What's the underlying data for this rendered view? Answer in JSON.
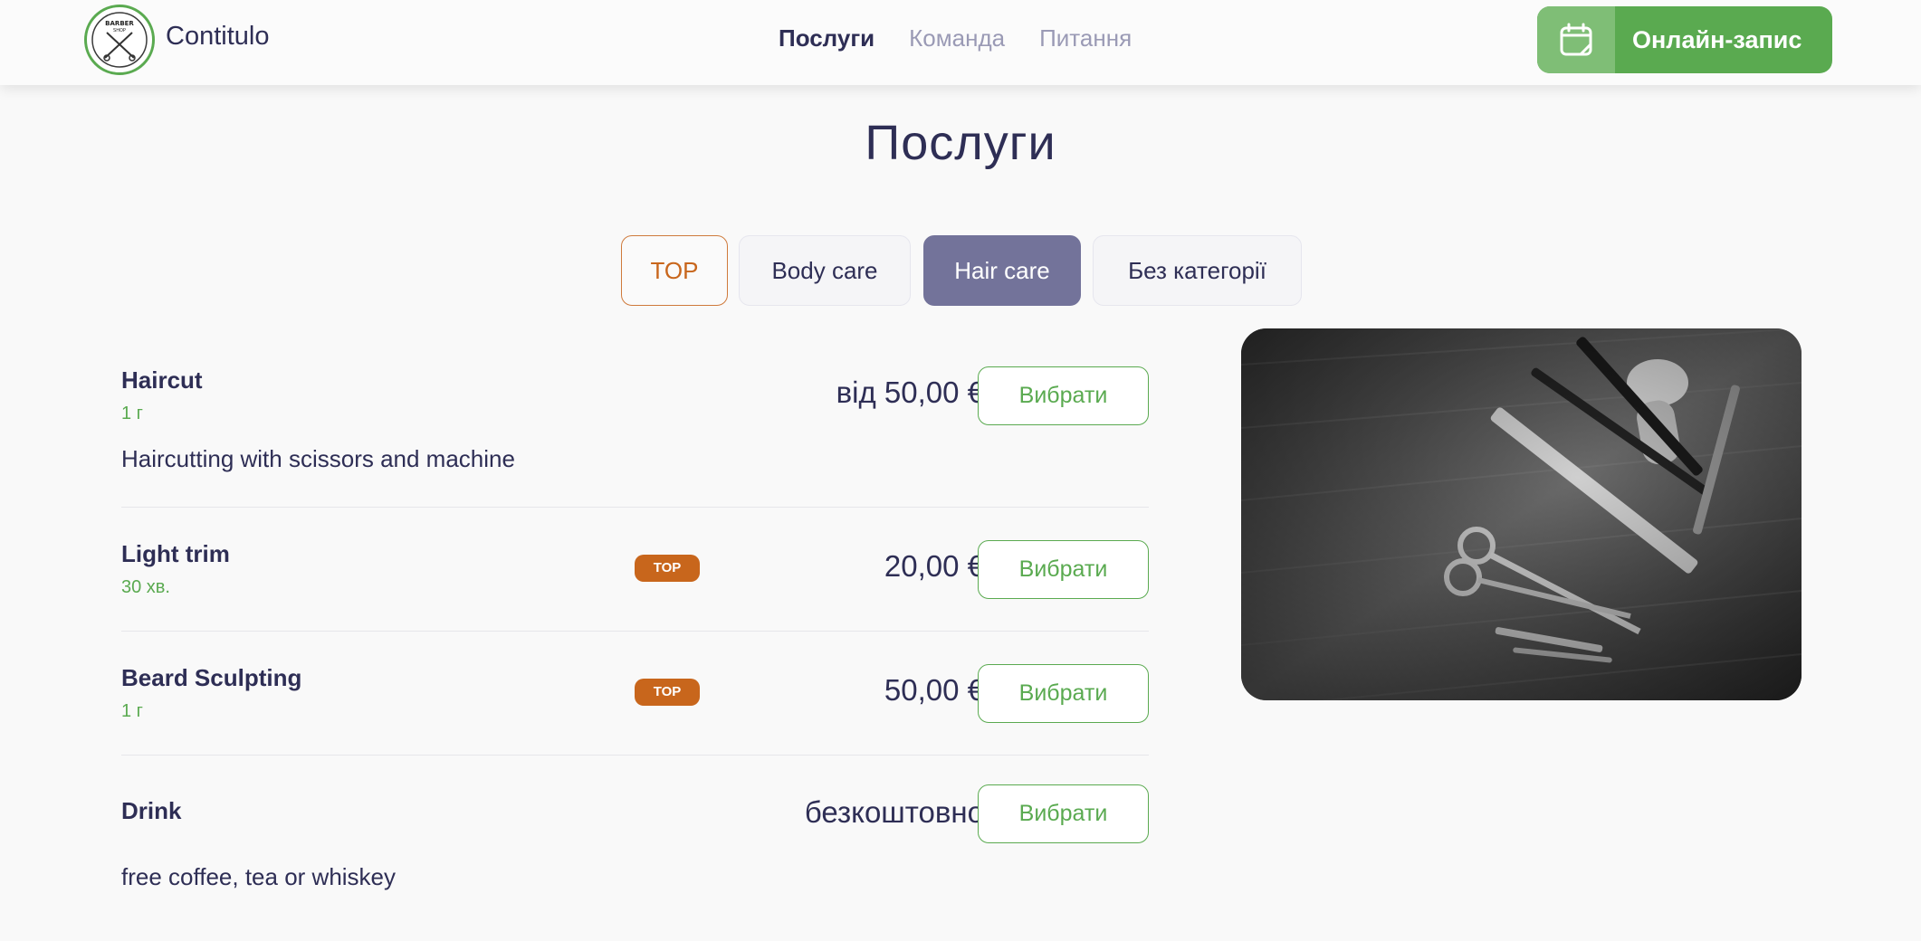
{
  "header": {
    "brand": "Contitulo",
    "logo_text": "BARBER SHOP",
    "nav": [
      {
        "label": "Послуги",
        "active": true
      },
      {
        "label": "Команда",
        "active": false
      },
      {
        "label": "Питання",
        "active": false
      }
    ],
    "cta": {
      "label": "Онлайн-запис",
      "icon": "calendar-icon"
    }
  },
  "page_title": "Послуги",
  "tabs": [
    {
      "label": "TOP",
      "state": "top"
    },
    {
      "label": "Body care",
      "state": "normal"
    },
    {
      "label": "Hair care",
      "state": "active"
    },
    {
      "label": "Без категорії",
      "state": "normal"
    }
  ],
  "services": [
    {
      "name": "Haircut",
      "duration": "1 г",
      "price": "від 50,00 €",
      "badge": "",
      "description": "Haircutting with scissors and machine",
      "button": "Вибрати"
    },
    {
      "name": "Light trim",
      "duration": "30 хв.",
      "price": "20,00 €",
      "badge": "TOP",
      "description": "",
      "button": "Вибрати"
    },
    {
      "name": "Beard Sculpting",
      "duration": "1 г",
      "price": "50,00 €",
      "badge": "TOP",
      "description": "",
      "button": "Вибрати"
    },
    {
      "name": "Drink",
      "duration": "",
      "price": "безкоштовно",
      "badge": "",
      "description": "free coffee, tea or whiskey",
      "button": "Вибрати"
    }
  ],
  "colors": {
    "accent_green": "#5aaa50",
    "badge_orange": "#c8661c",
    "active_tab": "#73739a",
    "text": "#2e2e55"
  }
}
